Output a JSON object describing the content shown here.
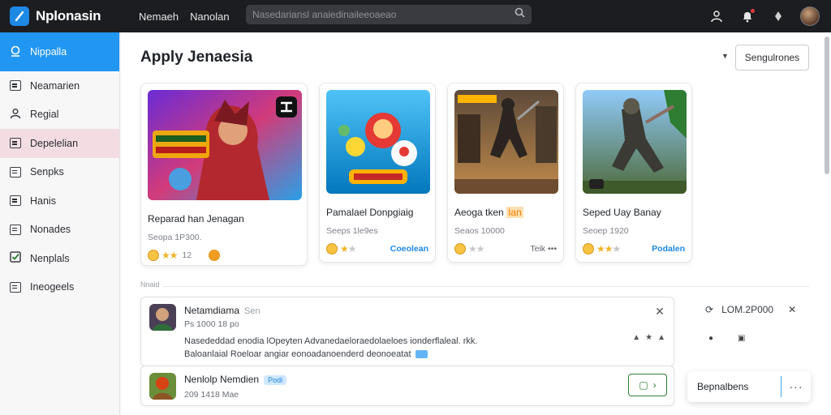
{
  "app": {
    "name": "Nplonasin",
    "nav": [
      "Nemaeh",
      "Nanolan"
    ],
    "search_placeholder": "Nasedariansl anaiedinaileeoaeao"
  },
  "sidebar": {
    "items": [
      {
        "label": "Nippalla",
        "state": "active"
      },
      {
        "label": "Neamarien",
        "state": "normal"
      },
      {
        "label": "Regial",
        "state": "normal"
      },
      {
        "label": "Depelelian",
        "state": "highlight"
      },
      {
        "label": "Senpks",
        "state": "normal"
      },
      {
        "label": "Hanis",
        "state": "normal"
      },
      {
        "label": "Nonades",
        "state": "normal"
      },
      {
        "label": "Nenplals",
        "state": "normal"
      },
      {
        "label": "Ineogeels",
        "state": "normal"
      }
    ]
  },
  "main": {
    "title": "Apply Jenaesia",
    "sort_button": "Sengulrones",
    "cards": [
      {
        "title": "Reparad han Jenagan",
        "meta": "Seopa 1P300.",
        "stars": 2,
        "rating": "12",
        "tag": ""
      },
      {
        "title": "Pamalael Donpgiaig",
        "meta": "Seeps 1le9es",
        "stars": 1,
        "rating": "",
        "tag": "Coeolean"
      },
      {
        "title": "Aeoga tken",
        "title_badge": "Ian",
        "meta": "Seaos 10000",
        "stars": 0,
        "rating": "",
        "tag": "Teik •••"
      },
      {
        "title": "Seped Uay Banay",
        "meta": "Seoep 1920",
        "stars": 2,
        "rating": "",
        "tag": "Podalen"
      }
    ],
    "section_label": "Nnaid",
    "notices": [
      {
        "title": "Netamdiama",
        "subtitle": "Sen",
        "meta": "Ps 1000 18 po",
        "body_line1": "Nasededdad enodia lOpeyten Advanedaeloraedolaeloes ionderflaleal. rkk.",
        "body_line2": "Baloanlaial Roeloar angiar eonoadanoenderd deonoeatat"
      },
      {
        "title": "Nenlolp Nemdien",
        "pill": "Podi",
        "meta": "209 1418 Mae"
      }
    ],
    "side_panel": {
      "label": "LOM.2P000"
    },
    "float_card": {
      "label": "Bepnalbens"
    }
  },
  "colors": {
    "topbar": "#1c1d21",
    "accent": "#2196f3",
    "highlight_item": "#f3dde3",
    "open_button": "#2e7d32"
  }
}
